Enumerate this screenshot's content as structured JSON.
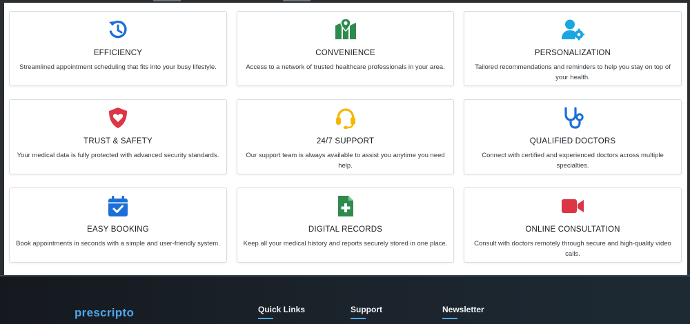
{
  "features": [
    {
      "icon": "history-icon",
      "color": "#1c6fd8",
      "title": "EFFICIENCY",
      "description": "Streamlined appointment scheduling that fits into your busy lifestyle."
    },
    {
      "icon": "map-marker-icon",
      "color": "#2e8b4e",
      "title": "CONVENIENCE",
      "description": "Access to a network of trusted healthcare professionals in your area."
    },
    {
      "icon": "user-gear-icon",
      "color": "#1aa6e0",
      "title": "PERSONALIZATION",
      "description": "Tailored recommendations and reminders to help you stay on top of your health."
    },
    {
      "icon": "shield-heart-icon",
      "color": "#dc3545",
      "title": "TRUST & SAFETY",
      "description": "Your medical data is fully protected with advanced security standards."
    },
    {
      "icon": "headset-icon",
      "color": "#f5b800",
      "title": "24/7 SUPPORT",
      "description": "Our support team is always available to assist you anytime you need help."
    },
    {
      "icon": "stethoscope-icon",
      "color": "#1c6fd8",
      "title": "QUALIFIED DOCTORS",
      "description": "Connect with certified and experienced doctors across multiple specialties."
    },
    {
      "icon": "calendar-check-icon",
      "color": "#1c6fd8",
      "title": "EASY BOOKING",
      "description": "Book appointments in seconds with a simple and user-friendly system."
    },
    {
      "icon": "medical-file-icon",
      "color": "#2e8b4e",
      "title": "DIGITAL RECORDS",
      "description": "Keep all your medical history and reports securely stored in one place."
    },
    {
      "icon": "video-camera-icon",
      "color": "#dc3545",
      "title": "ONLINE CONSULTATION",
      "description": "Consult with doctors remotely through secure and high-quality video calls."
    }
  ],
  "footer": {
    "brand": "prescripto",
    "columns": [
      "Quick Links",
      "Support",
      "Newsletter"
    ],
    "accent": "#4fa6e8"
  }
}
